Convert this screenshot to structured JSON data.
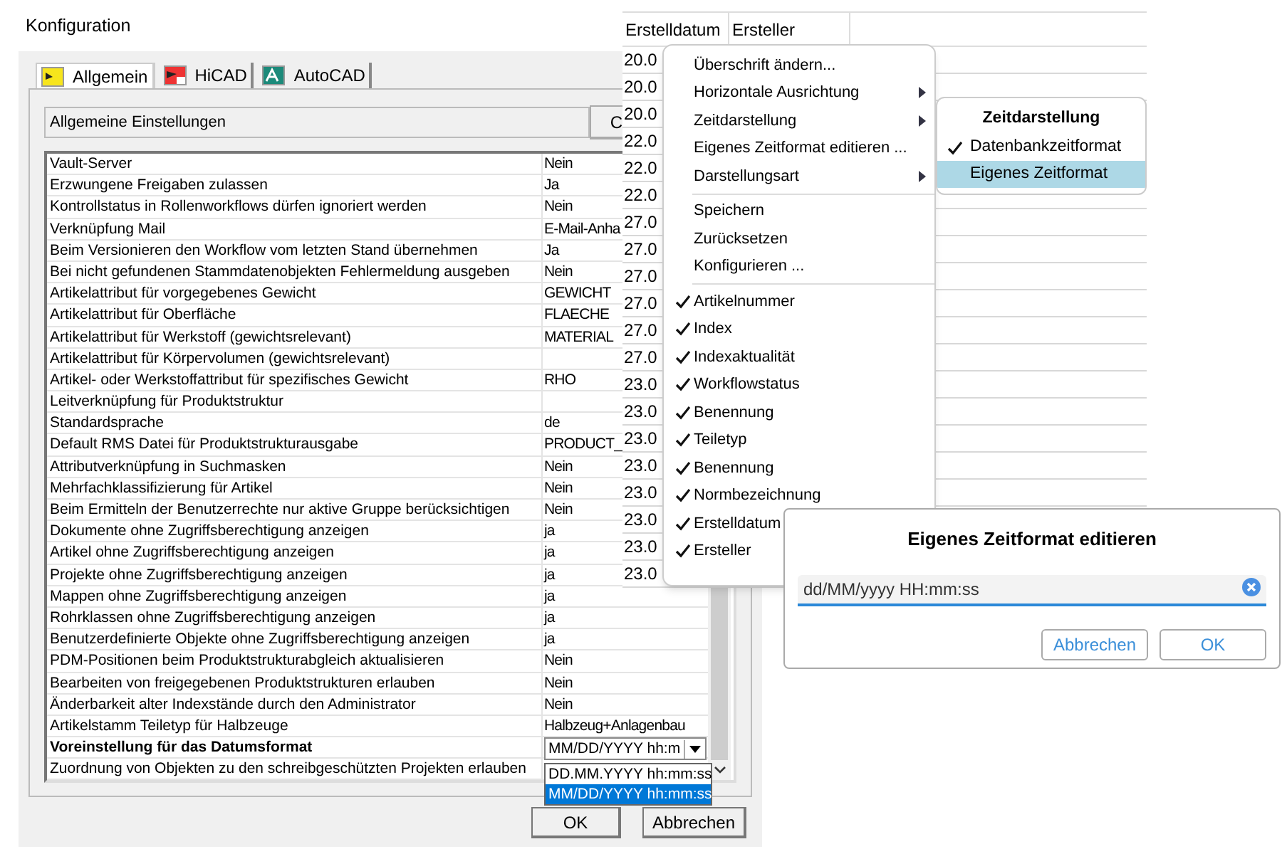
{
  "dialog": {
    "title": "Konfiguration",
    "tabs": [
      {
        "label": "Allgemein",
        "selected": true
      },
      {
        "label": "HiCAD",
        "selected": false
      },
      {
        "label": "AutoCAD",
        "selected": false
      }
    ],
    "section_field": {
      "value": "Allgemeine Einstellungen"
    },
    "side_button": "C",
    "settings": [
      {
        "label": "Vault-Server",
        "value": "Nein",
        "kind": "text",
        "selected": false
      },
      {
        "label": "Erzwungene Freigaben zulassen",
        "value": "Ja",
        "kind": "text",
        "selected": false
      },
      {
        "label": "Kontrollstatus in Rollenworkflows dürfen ignoriert werden",
        "value": "Nein",
        "kind": "text",
        "selected": false
      },
      {
        "label": "Verknüpfung Mail",
        "value": "E-Mail-Anha",
        "kind": "text",
        "selected": false
      },
      {
        "label": "Beim Versionieren den Workflow vom letzten Stand übernehmen",
        "value": "Ja",
        "kind": "text",
        "selected": false
      },
      {
        "label": "Bei nicht gefundenen Stammdatenobjekten Fehlermeldung ausgeben",
        "value": "Nein",
        "kind": "text",
        "selected": false
      },
      {
        "label": "Artikelattribut für vorgegebenes Gewicht",
        "value": "GEWICHT",
        "kind": "text",
        "selected": false
      },
      {
        "label": "Artikelattribut für Oberfläche",
        "value": "FLAECHE",
        "kind": "text",
        "selected": false
      },
      {
        "label": "Artikelattribut für Werkstoff (gewichtsrelevant)",
        "value": "MATERIAL",
        "kind": "text",
        "selected": false
      },
      {
        "label": "Artikelattribut für Körpervolumen (gewichtsrelevant)",
        "kind": "text",
        "selected": false
      },
      {
        "label": "Artikel- oder Werkstoffattribut für spezifisches Gewicht",
        "value": "RHO",
        "kind": "text",
        "selected": false
      },
      {
        "label": "Leitverknüpfung für Produktstruktur",
        "kind": "text",
        "selected": false
      },
      {
        "label": "Standardsprache",
        "value": "de",
        "kind": "text",
        "selected": false
      },
      {
        "label": "Default RMS Datei für Produktstrukturausgabe",
        "value": "PRODUCT_",
        "kind": "text",
        "selected": false
      },
      {
        "label": "Attributverknüpfung in Suchmasken",
        "value": "Nein",
        "kind": "text",
        "selected": false
      },
      {
        "label": "Mehrfachklassifizierung für Artikel",
        "value": "Nein",
        "kind": "text",
        "selected": false
      },
      {
        "label": "Beim Ermitteln der Benutzerrechte nur aktive Gruppe berücksichtigen",
        "value": "Nein",
        "kind": "text",
        "selected": false
      },
      {
        "label": "Dokumente ohne Zugriffsberechtigung anzeigen",
        "value": "ja",
        "kind": "text",
        "selected": false
      },
      {
        "label": "Artikel ohne Zugriffsberechtigung anzeigen",
        "value": "ja",
        "kind": "text",
        "selected": false
      },
      {
        "label": "Projekte ohne Zugriffsberechtigung anzeigen",
        "value": "ja",
        "kind": "text",
        "selected": false
      },
      {
        "label": "Mappen ohne Zugriffsberechtigung anzeigen",
        "value": "ja",
        "kind": "text",
        "selected": false
      },
      {
        "label": "Rohrklassen ohne Zugriffsberechtigung anzeigen",
        "value": "ja",
        "kind": "text",
        "selected": false
      },
      {
        "label": "Benutzerdefinierte Objekte ohne Zugriffsberechtigung anzeigen",
        "value": "ja",
        "kind": "text",
        "selected": false
      },
      {
        "label": "PDM-Positionen beim Produktstrukturabgleich aktualisieren",
        "value": "Nein",
        "kind": "text",
        "selected": false
      },
      {
        "label": "Bearbeiten von freigegebenen Produktstrukturen erlauben",
        "value": "Nein",
        "kind": "text",
        "selected": false
      },
      {
        "label": "Änderbarkeit alter Indexstände durch den Administrator",
        "value": "Nein",
        "kind": "text",
        "selected": false
      },
      {
        "label": "Artikelstamm Teiletyp für Halbzeuge",
        "value": "Halbzeug+Anlagenbau",
        "kind": "text",
        "selected": false
      },
      {
        "label": "Voreinstellung für das Datumsformat",
        "value": "MM/DD/YYYY hh:m",
        "kind": "dropdown",
        "selected": true
      },
      {
        "label": "Zuordnung von Objekten zu den schreibgeschützten Projekten erlauben",
        "kind": "text",
        "selected": false
      }
    ],
    "dropdown_options": [
      {
        "label": "DD.MM.YYYY hh:mm:ss",
        "selected": false
      },
      {
        "label": "MM/DD/YYYY hh:mm:ss",
        "selected": true
      }
    ],
    "buttons": [
      "OK",
      "Abbrechen"
    ]
  },
  "grid": {
    "columns": [
      "Erstelldatum",
      "Ersteller"
    ],
    "rows": [
      "20.0",
      "20.0",
      "20.0",
      "22.0",
      "22.0",
      "22.0",
      "27.0",
      "27.0",
      "27.0",
      "27.0",
      "27.0",
      "27.0",
      "23.0",
      "23.0",
      "23.0",
      "23.0",
      "23.0",
      "23.0",
      "23.0",
      "23.0"
    ]
  },
  "context_menu": {
    "items": [
      {
        "kind": "action",
        "label": "Überschrift ändern..."
      },
      {
        "kind": "submenu",
        "label": "Horizontale Ausrichtung"
      },
      {
        "kind": "submenu",
        "label": "Zeitdarstellung"
      },
      {
        "kind": "action",
        "label": "Eigenes Zeitformat editieren ..."
      },
      {
        "kind": "submenu",
        "label": "Darstellungsart"
      },
      {
        "kind": "separator"
      },
      {
        "kind": "action",
        "label": "Speichern"
      },
      {
        "kind": "action",
        "label": "Zurücksetzen"
      },
      {
        "kind": "action",
        "label": "Konfigurieren ..."
      },
      {
        "kind": "separator"
      },
      {
        "kind": "check",
        "label": "Artikelnummer",
        "checked": true
      },
      {
        "kind": "check",
        "label": "Index",
        "checked": true
      },
      {
        "kind": "check",
        "label": "Indexaktualität",
        "checked": true
      },
      {
        "kind": "check",
        "label": "Workflowstatus",
        "checked": true
      },
      {
        "kind": "check",
        "label": "Benennung",
        "checked": true
      },
      {
        "kind": "check",
        "label": "Teiletyp",
        "checked": true
      },
      {
        "kind": "check",
        "label": "Benennung",
        "checked": true
      },
      {
        "kind": "check",
        "label": "Normbezeichnung",
        "checked": true
      },
      {
        "kind": "check",
        "label": "Erstelldatum",
        "checked": true
      },
      {
        "kind": "check",
        "label": "Ersteller",
        "checked": true
      }
    ]
  },
  "submenu": {
    "title": "Zeitdarstellung",
    "items": [
      {
        "label": "Datenbankzeitformat",
        "checked": true,
        "selected": false
      },
      {
        "label": "Eigenes Zeitformat",
        "checked": false,
        "selected": true
      }
    ]
  },
  "edit_dialog": {
    "title": "Eigenes Zeitformat editieren",
    "value": "dd/MM/yyyy HH:mm:ss",
    "buttons": [
      "Abbrechen",
      "OK"
    ]
  }
}
